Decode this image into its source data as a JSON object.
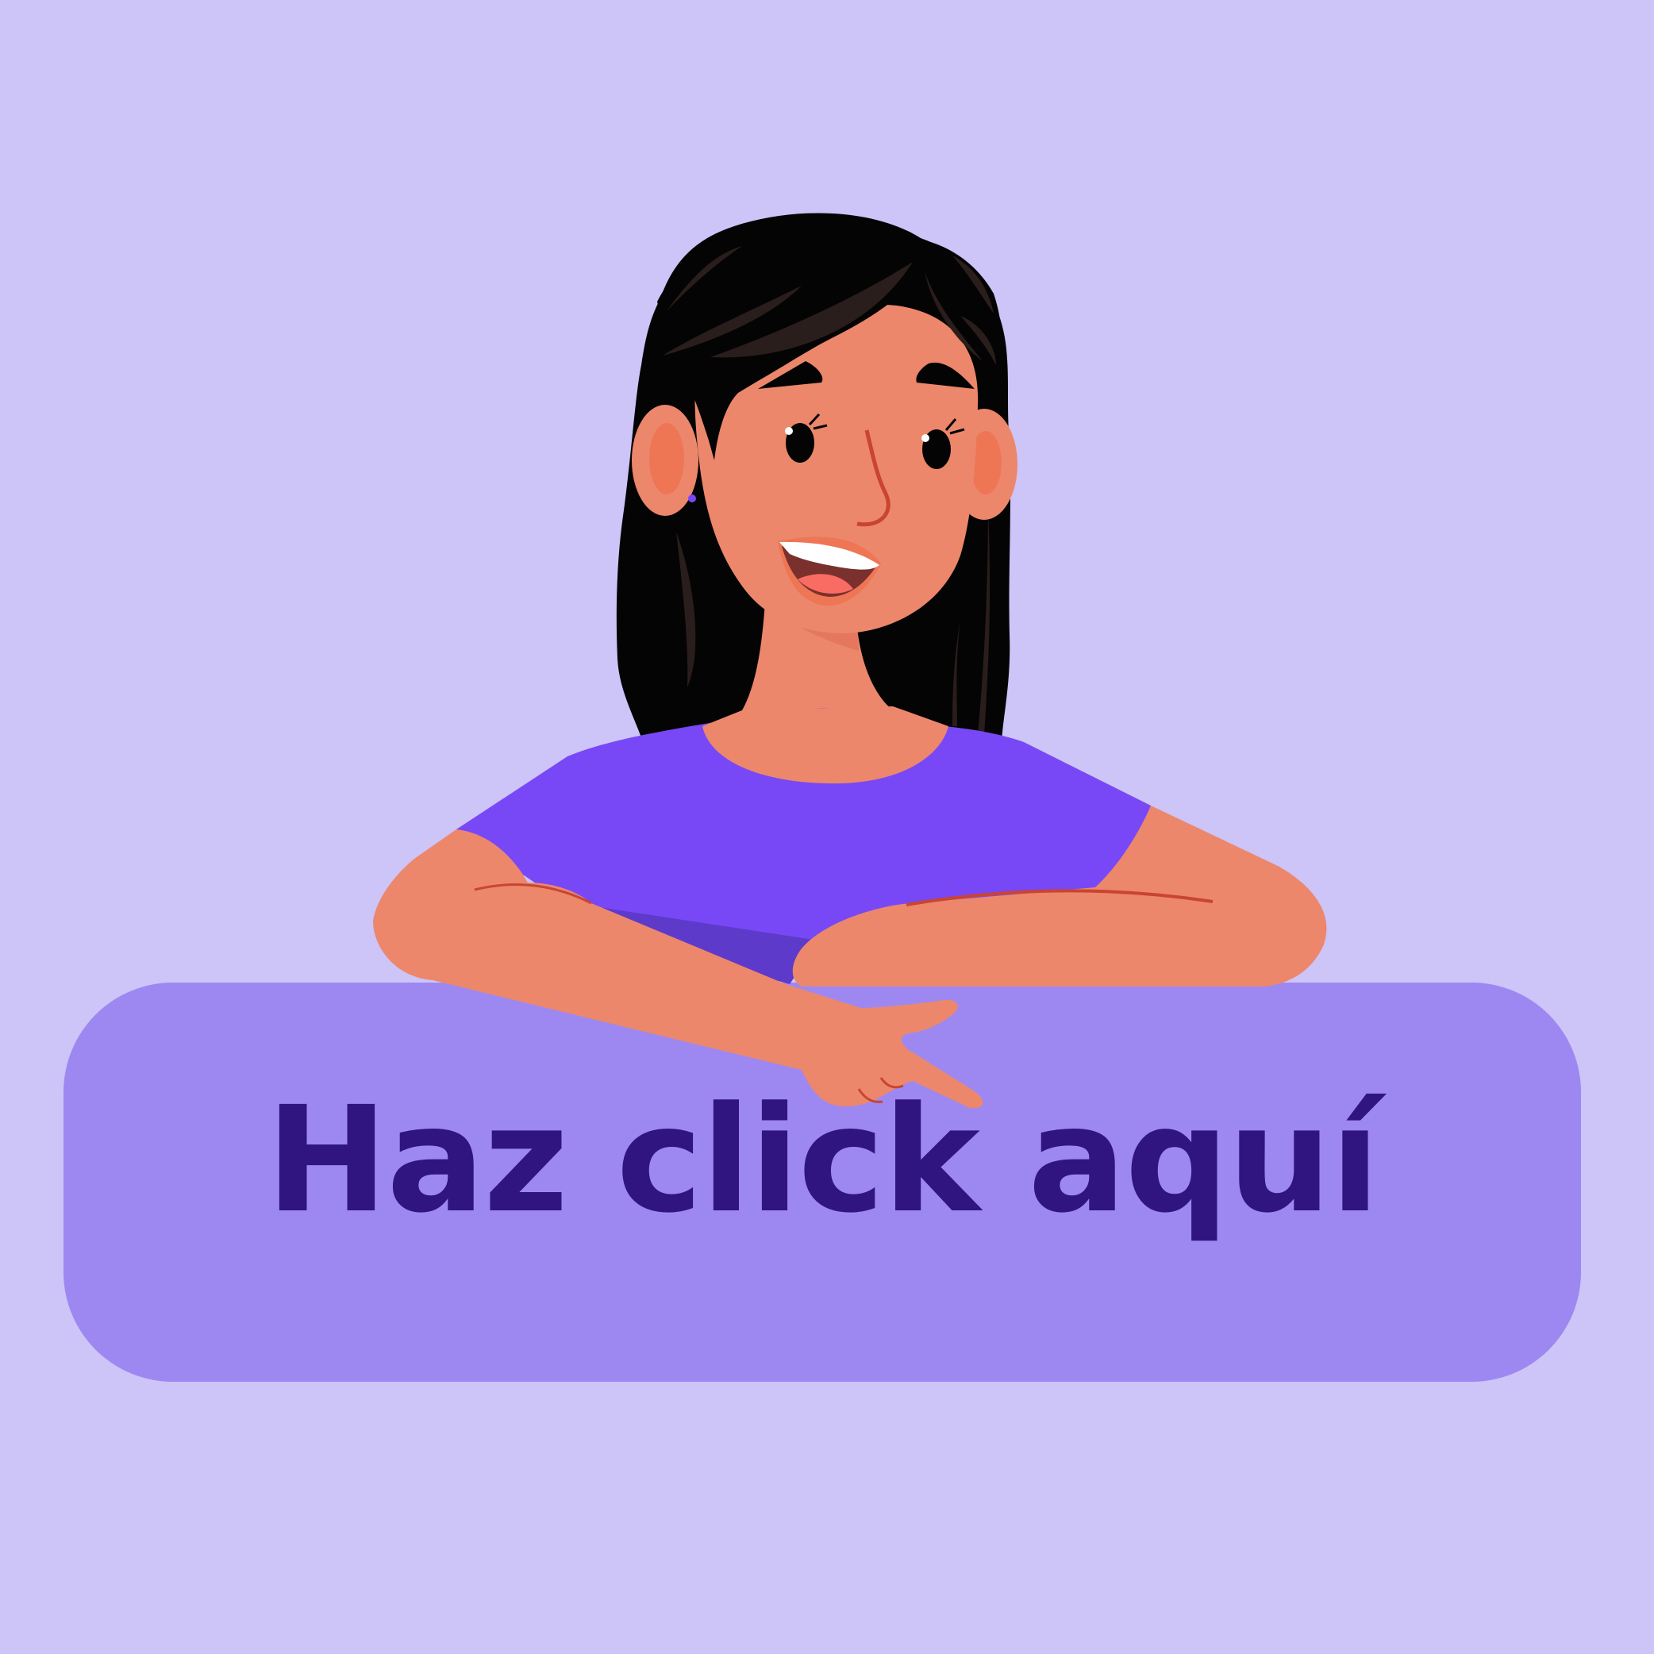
{
  "cta": {
    "label": "Haz click aquí"
  },
  "colors": {
    "background": "#cdc4f8",
    "button": "#9d88f2",
    "button_text": "#301581",
    "shirt": "#7848f6",
    "skin": "#ec876c",
    "hair": "#050404"
  },
  "illustration": {
    "subject": "woman-leaning-on-button",
    "gesture": "pointing-down"
  }
}
